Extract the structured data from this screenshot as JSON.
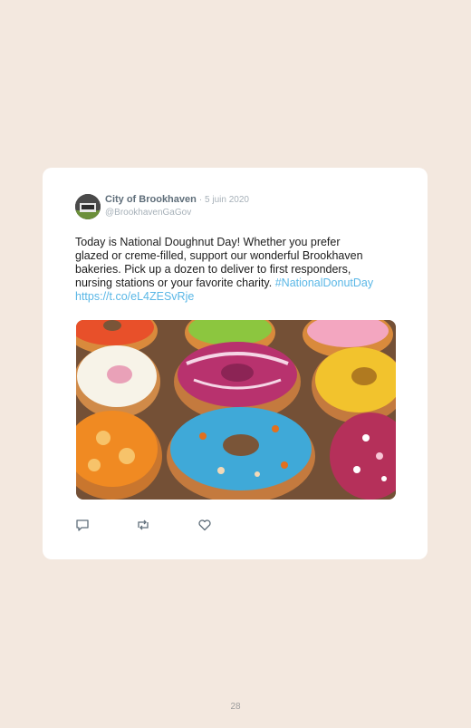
{
  "tweet": {
    "author_name": "City of Brookhaven",
    "date": "· 5 juin 2020",
    "handle": "@BrookhavenGaGov",
    "text_lines": [
      "Today is National Doughnut Day! Whether you prefer",
      "glazed or creme-filled, support our wonderful Brookhaven",
      "bakeries. Pick up a dozen to deliver to first responders,",
      "nursing stations or your favorite charity."
    ],
    "hashtag": "#NationalDonutDay",
    "url": "https://t.co/eL4ZESvRje"
  },
  "icons": {
    "reply": "reply-icon",
    "retweet": "retweet-icon",
    "like": "heart-icon"
  },
  "colors": {
    "page_background": "#f3e8df",
    "card_background": "#ffffff",
    "link": "#5ab7e6",
    "name": "#5f6e7a",
    "meta": "#a7b1b9"
  },
  "page_number": "28"
}
